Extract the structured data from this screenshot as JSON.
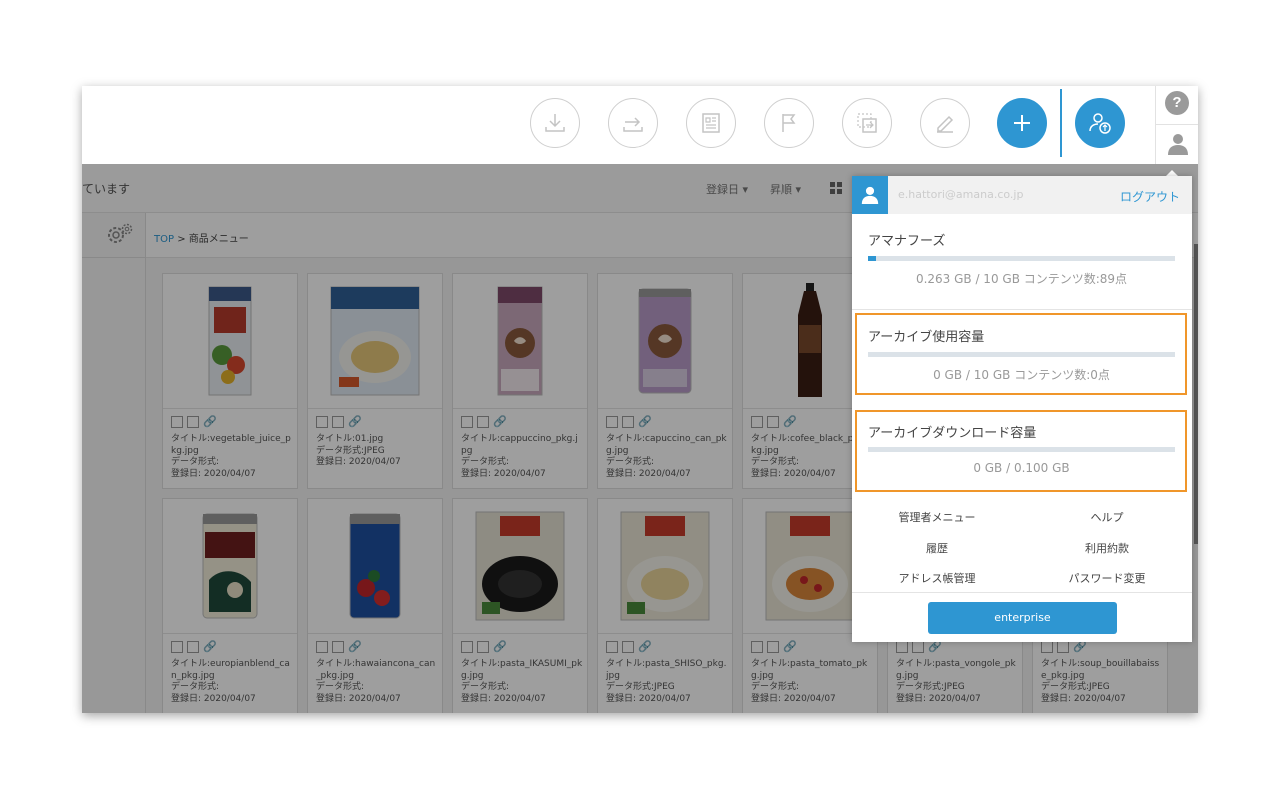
{
  "colors": {
    "accent": "#2e96d2",
    "highlight": "#f0962a",
    "overlay": "rgba(0,0,0,0.38)"
  },
  "toolbar": {
    "buttons": [
      {
        "name": "download-icon"
      },
      {
        "name": "export-icon"
      },
      {
        "name": "document-icon"
      },
      {
        "name": "flag-icon"
      },
      {
        "name": "move-icon"
      },
      {
        "name": "edit-icon"
      },
      {
        "name": "plus-icon"
      },
      {
        "name": "user-upload-icon"
      }
    ],
    "help_label": "?"
  },
  "subbar": {
    "status_text": "ています",
    "sort_field": "登録日",
    "sort_order": "昇順"
  },
  "breadcrumb": {
    "top": "TOP",
    "separator": ">",
    "current": "商品メニュー"
  },
  "items": [
    {
      "title": "タイトル:vegetable_juice_pkg.jpg",
      "format": "データ形式:",
      "date": "登録日: 2020/04/07"
    },
    {
      "title": "タイトル:01.jpg",
      "format": "データ形式:JPEG",
      "date": "登録日: 2020/04/07"
    },
    {
      "title": "タイトル:cappuccino_pkg.jpg",
      "format": "データ形式:",
      "date": "登録日: 2020/04/07"
    },
    {
      "title": "タイトル:capuccino_can_pkg.jpg",
      "format": "データ形式:",
      "date": "登録日: 2020/04/07"
    },
    {
      "title": "タイトル:cofee_black_pe",
      "title2": "kg.jpg",
      "format": "データ形式:",
      "date": "登録日: 2020/04/07"
    },
    {
      "title": "タイトル:europianblend_can_pkg.jpg",
      "format": "データ形式:",
      "date": "登録日: 2020/04/07"
    },
    {
      "title": "タイトル:hawaiancona_can_pkg.jpg",
      "format": "データ形式:",
      "date": "登録日: 2020/04/07"
    },
    {
      "title": "タイトル:pasta_IKASUMI_pkg.jpg",
      "format": "データ形式:",
      "date": "登録日: 2020/04/07"
    },
    {
      "title": "タイトル:pasta_SHISO_pkg.jpg",
      "format": "データ形式:JPEG",
      "date": "登録日: 2020/04/07"
    },
    {
      "title": "タイトル:pasta_tomato_pkg.jpg",
      "format": "データ形式:",
      "date": "登録日: 2020/04/07"
    },
    {
      "title": "タイトル:pasta_vongole_pkg.jpg",
      "format": "データ形式:JPEG",
      "date": "登録日: 2020/04/07"
    },
    {
      "title": "タイトル:soup_bouillabaisse_pkg.jpg",
      "format": "データ形式:JPEG",
      "date": "登録日: 2020/04/07"
    }
  ],
  "account_panel": {
    "email": "e.hattori@amana.co.jp",
    "logout": "ログアウト",
    "org_name": "アマナフーズ",
    "org_usage": "0.263 GB / 10 GB  コンテンツ数:89点",
    "org_usage_fraction": 0.0263,
    "archive_title": "アーカイブ使用容量",
    "archive_usage": "0 GB / 10 GB  コンテンツ数:0点",
    "archive_usage_fraction": 0,
    "download_title": "アーカイブダウンロード容量",
    "download_usage": "0 GB / 0.100 GB",
    "download_usage_fraction": 0,
    "menu": {
      "admin": "管理者メニュー",
      "help": "ヘルプ",
      "history": "履歴",
      "terms": "利用約款",
      "addressbook": "アドレス帳管理",
      "password": "パスワード変更"
    },
    "plan_button": "enterprise"
  }
}
